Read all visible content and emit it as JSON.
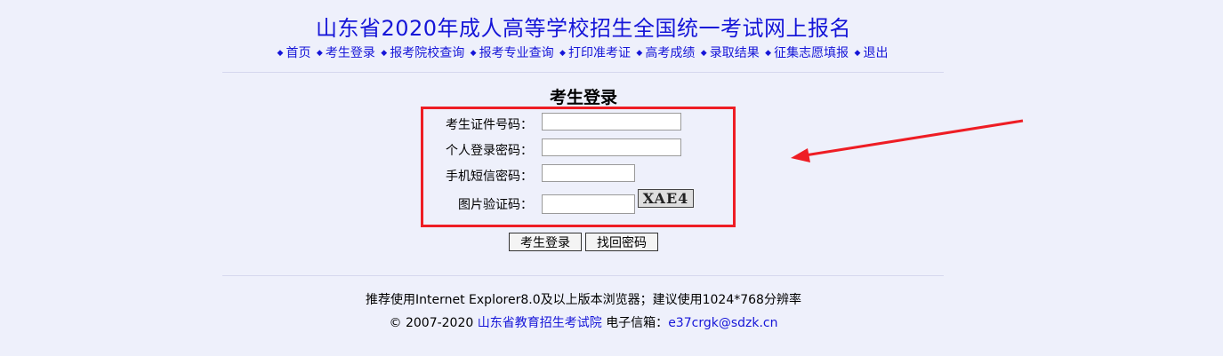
{
  "header": {
    "title": "山东省2020年成人高等学校招生全国统一考试网上报名",
    "nav": [
      {
        "label": "首页"
      },
      {
        "label": "考生登录"
      },
      {
        "label": "报考院校查询"
      },
      {
        "label": "报考专业查询"
      },
      {
        "label": "打印准考证"
      },
      {
        "label": "高考成绩"
      },
      {
        "label": "录取结果"
      },
      {
        "label": "征集志愿填报"
      },
      {
        "label": "退出"
      }
    ],
    "bullet": "◆"
  },
  "login": {
    "title": "考生登录",
    "fields": {
      "id_label": "考生证件号码：",
      "id_value": "",
      "password_label": "个人登录密码：",
      "password_value": "",
      "sms_label": "手机短信密码：",
      "sms_value": "",
      "captcha_label": "图片验证码：",
      "captcha_value": "",
      "captcha_image_text": "XAE4"
    },
    "buttons": {
      "login": "考生登录",
      "recover": "找回密码"
    }
  },
  "footer": {
    "browser_note": "推荐使用Internet Explorer8.0及以上版本浏览器；建议使用1024*768分辨率",
    "copyright": "© 2007-2020",
    "org_link": "山东省教育招生考试院",
    "email_label": "电子信箱：",
    "email": "e37crgk@sdzk.cn"
  },
  "colors": {
    "link": "#1515d8",
    "highlight_box": "#ee1d24",
    "background": "#eef0fb"
  }
}
